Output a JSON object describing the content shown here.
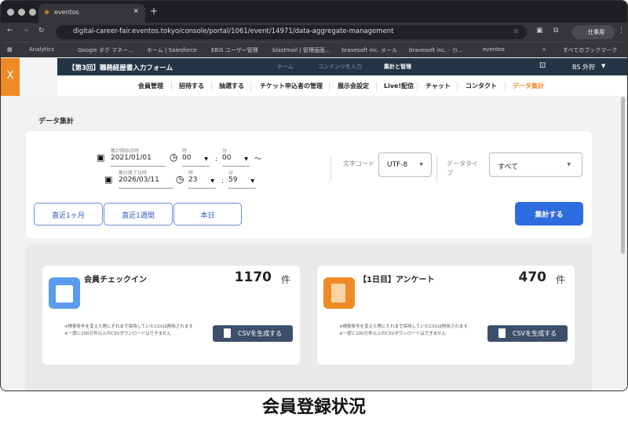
{
  "browser": {
    "tab_title": "eventos",
    "url": "digital-career-fair.eventos.tokyo/console/portal/1061/event/14971/data-aggregate-management",
    "profile": "仕事用",
    "bookmarks": [
      "Analytics",
      "Google タグ マネー...",
      "ホーム | Salesforce",
      "EBiS ユーザー管理",
      "blastmail | 管理画面...",
      "bravesoft inc. メール",
      "bravesoft inc. - カ...",
      "eventos"
    ],
    "all_bookmarks": "すべてのブックマーク"
  },
  "header": {
    "close": "X",
    "event_title": "【第3回】職務経歴書入力フォーム",
    "top_nav": [
      "ホーム",
      "コンテンツを入力",
      "集計と管理"
    ],
    "user": "BS 外狩"
  },
  "subnav": [
    "会員管理",
    "招待する",
    "抽選する",
    "チケット申込者の管理",
    "展示会設定",
    "Live!配信",
    "チャット",
    "コンタクト",
    "データ集計"
  ],
  "page_title": "データ集計",
  "filters": {
    "start_label": "集計開始日時",
    "start_date": "2021/01/01",
    "hour_label": "時",
    "minute_label": "分",
    "start_hour": "00",
    "start_minute": "00",
    "tilde": "〜",
    "end_label": "集計終了日時",
    "end_date": "2026/03/11",
    "end_hour": "23",
    "end_minute": "59",
    "encoding_label": "文字コード",
    "encoding": "UTF-8",
    "type_label": "データタイプ",
    "type": "すべて"
  },
  "quick_buttons": [
    "直近1ヶ月",
    "直近1週間",
    "本日"
  ],
  "run_button": "集計する",
  "cards": [
    {
      "name": "会員チェックイン",
      "count": "1170",
      "unit": "件",
      "note1": "※検索条件を変えた際にそれまで保持していたCSVは削除されます",
      "note2": "※一度に100万件以上のCSVダウンロードはできません",
      "button": "CSVを生成する",
      "icon_color": "#5b9cf0"
    },
    {
      "name": "【1日目】アンケート",
      "count": "470",
      "unit": "件",
      "note1": "※検索条件を変えた際にそれまで保持していたCSVは削除されます",
      "note2": "※一度に100万件以上のCSVダウンロードはできません",
      "button": "CSVを生成する",
      "icon_color": "#f08a24"
    }
  ],
  "caption": "会員登録状況",
  "colors": {
    "accent": "#f08a24",
    "navy": "#243447",
    "primary": "#2d6be0"
  }
}
